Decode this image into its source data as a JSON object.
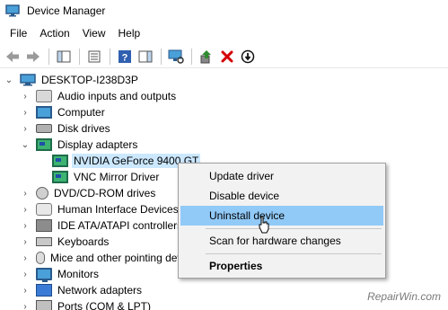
{
  "window": {
    "title": "Device Manager"
  },
  "menu": [
    "File",
    "Action",
    "View",
    "Help"
  ],
  "toolbar": {
    "icons": [
      "back-arrow-icon",
      "forward-arrow-icon",
      "properties-icon",
      "console-tree-icon",
      "help-icon",
      "action-pane-icon",
      "scan-hardware-icon",
      "update-driver-icon",
      "uninstall-icon",
      "disable-icon"
    ],
    "colors": {
      "uninstall": "#d40000",
      "update": "#2e8b2e"
    }
  },
  "tree": {
    "root": "DESKTOP-I238D3P",
    "items": [
      {
        "label": "Audio inputs and outputs",
        "icon": "speaker-icon"
      },
      {
        "label": "Computer",
        "icon": "computer-icon"
      },
      {
        "label": "Disk drives",
        "icon": "disk-drive-icon"
      },
      {
        "label": "Display adapters",
        "icon": "display-adapter-icon",
        "expanded": true
      },
      {
        "label": "NVIDIA GeForce 9400 GT",
        "icon": "display-adapter-icon",
        "child": true,
        "selected": true
      },
      {
        "label": "VNC Mirror Driver",
        "icon": "display-adapter-icon",
        "child": true
      },
      {
        "label": "DVD/CD-ROM drives",
        "icon": "dvd-drive-icon"
      },
      {
        "label": "Human Interface Devices",
        "icon": "hid-icon"
      },
      {
        "label": "IDE ATA/ATAPI controllers",
        "icon": "ide-controller-icon"
      },
      {
        "label": "Keyboards",
        "icon": "keyboard-icon"
      },
      {
        "label": "Mice and other pointing devices",
        "icon": "mouse-icon"
      },
      {
        "label": "Monitors",
        "icon": "monitor-icon"
      },
      {
        "label": "Network adapters",
        "icon": "network-adapter-icon"
      },
      {
        "label": "Ports (COM & LPT)",
        "icon": "port-icon"
      }
    ]
  },
  "context_menu": {
    "items": [
      "Update driver",
      "Disable device",
      "Uninstall device",
      "Scan for hardware changes",
      "Properties"
    ],
    "highlighted": "Uninstall device"
  },
  "watermark": "RepairWin.com"
}
